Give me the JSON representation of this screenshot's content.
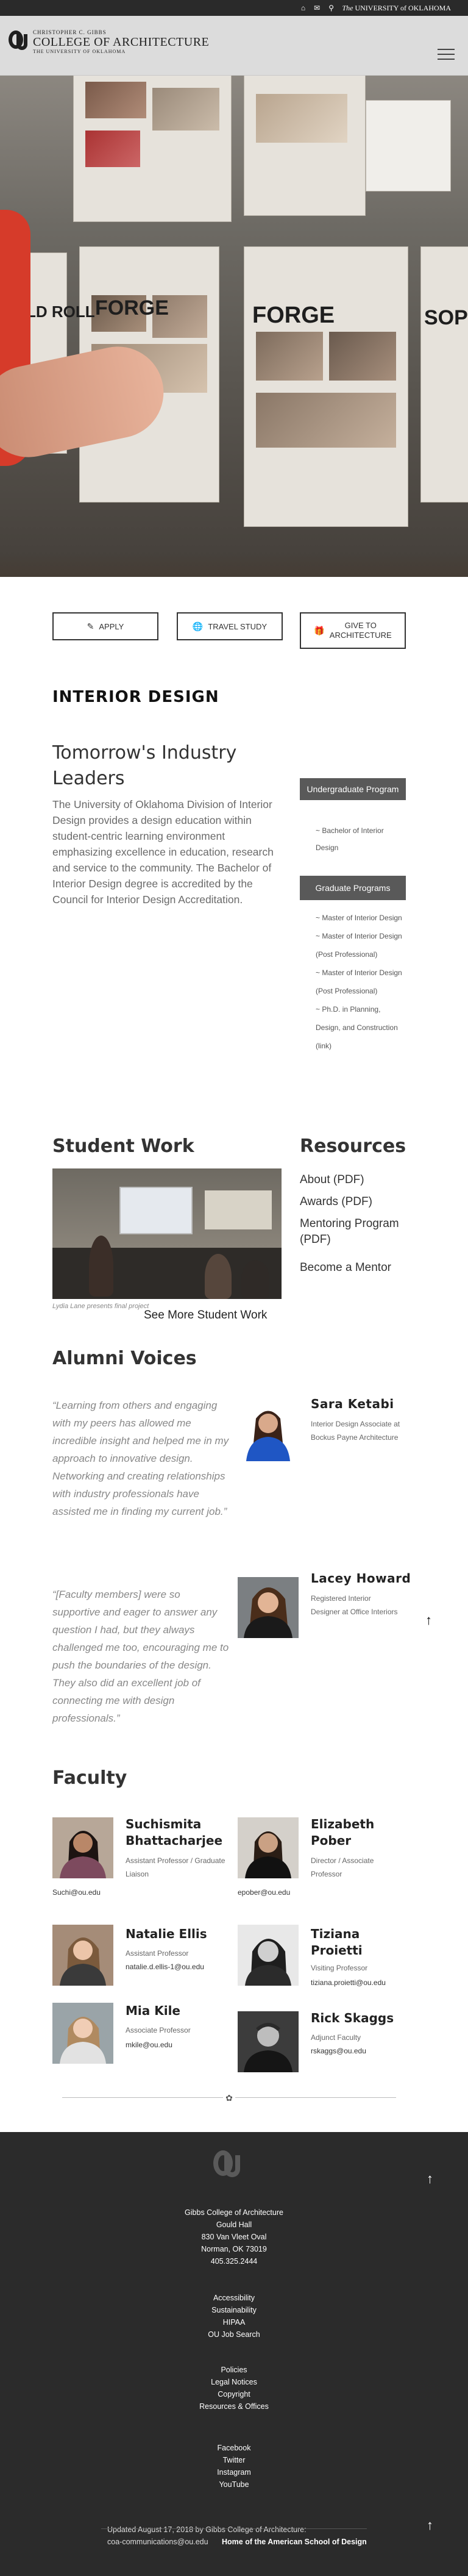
{
  "topbar": {
    "icons": [
      "home-icon",
      "mail-icon",
      "search-icon"
    ],
    "ou_prefix": "The",
    "ou_name": "UNIVERSITY of OKLAHOMA"
  },
  "header": {
    "line1": "Christopher C. Gibbs",
    "line2": "COLLEGE OF ARCHITECTURE",
    "line3": "The University of Oklahoma"
  },
  "hero": {
    "signs": [
      "COLD ROLL",
      "FORGE",
      "FORGE",
      "SOPH"
    ]
  },
  "actions": [
    {
      "label": "APPLY",
      "icon": "edit-icon"
    },
    {
      "label": "TRAVEL STUDY",
      "icon": "globe-icon"
    },
    {
      "label": "GIVE TO ARCHITECTURE",
      "icon": "gift-icon"
    }
  ],
  "page_title": "INTERIOR DESIGN",
  "intro": {
    "heading": "Tomorrow's Industry Leaders",
    "body": "The University of Oklahoma Division of Interior Design provides a design education within student-centric learning environment emphasizing excellence in education, research and service to the community. The Bachelor of Interior Design degree is accredited by the Council for Interior Design Accreditation."
  },
  "programs": {
    "undergrad_label": "Undergraduate Program",
    "undergrad_items": [
      "~ Bachelor of Interior Design"
    ],
    "grad_label": "Graduate Programs",
    "grad_items": [
      "~ Master of Interior Design",
      "~ Master of Interior Design (Post Professional)",
      "~ Master of Interior Design (Post Professional)",
      "~ Ph.D. in Planning, Design, and Construction (link)"
    ]
  },
  "student_work": {
    "heading": "Student Work",
    "caption": "Lydia Lane presents final project",
    "see_more": "See More Student Work"
  },
  "resources": {
    "heading": "Resources",
    "items": [
      "About (PDF)",
      "Awards (PDF)",
      "Mentoring Program (PDF)",
      "Become a Mentor"
    ]
  },
  "alumni": {
    "heading": "Alumni Voices",
    "people": [
      {
        "quote": "“Learning from others and engaging with my peers has allowed me incredible insight and helped me in my approach to innovative design. Networking and creating relationships with industry professionals have assisted me in finding my current job.”",
        "name": "Sara Ketabi",
        "role": "Interior Design Associate at Bockus Payne Architecture"
      },
      {
        "quote": "“[Faculty members] were so supportive and eager to answer any question I had, but they always challenged me too, encouraging me to push the boundaries of the design. They also did an excellent job of connecting me with design professionals.”",
        "name": "Lacey Howard",
        "role": "Registered Interior Designer at Office Interiors"
      }
    ]
  },
  "faculty": {
    "heading": "Faculty",
    "people": [
      {
        "name": "Suchismita Bhattacharjee",
        "role": "Assistant Professor / Graduate Liaison",
        "email": "Suchi@ou.edu"
      },
      {
        "name": "Elizabeth Pober",
        "role": "Director / Associate Professor",
        "email": "epober@ou.edu"
      },
      {
        "name": "Natalie Ellis",
        "role": "Assistant Professor",
        "email": "natalie.d.ellis-1@ou.edu"
      },
      {
        "name": "Tiziana Proietti",
        "role": "Visiting Professor",
        "email": "tiziana.proietti@ou.edu"
      },
      {
        "name": "Mia Kile",
        "role": "Associate Professor",
        "email": "mkile@ou.edu"
      },
      {
        "name": "Rick Skaggs",
        "role": "Adjunct Faculty",
        "email": "rskaggs@ou.edu"
      }
    ]
  },
  "footer": {
    "address": [
      "Gibbs College of Architecture",
      "Gould Hall",
      "830 Van Vleet Oval",
      "Norman, OK 73019",
      "405.325.2444"
    ],
    "links1": [
      "Accessibility",
      "Sustainability",
      "HIPAA",
      "OU Job Search"
    ],
    "links2": [
      "Policies",
      "Legal Notices",
      "Copyright",
      "Resources & Offices"
    ],
    "social": [
      "Facebook",
      "Twitter",
      "Instagram",
      "YouTube"
    ],
    "updated": "Updated August 17, 2018 by Gibbs College of Architecture: coa-communications@ou.edu",
    "home": "Home of the American School of Design"
  }
}
